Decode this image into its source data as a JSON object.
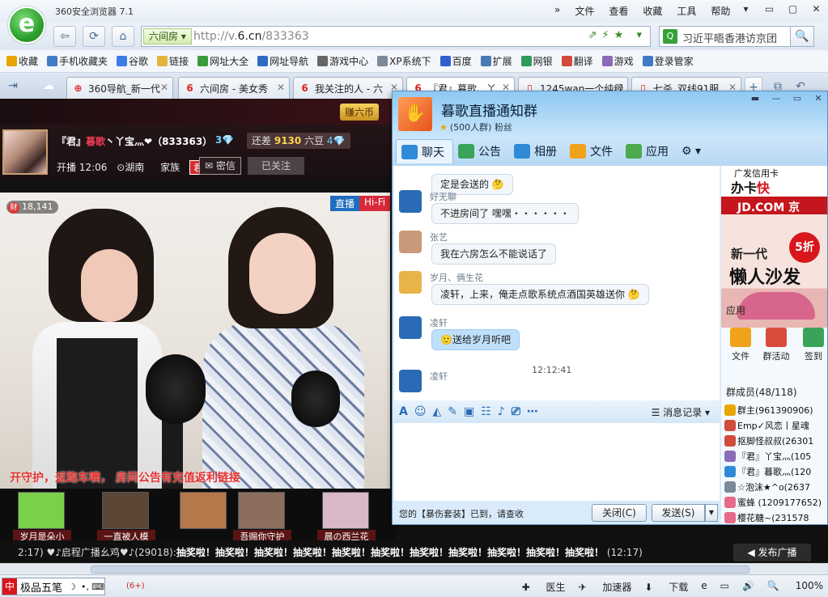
{
  "browser": {
    "title": "360安全浏览器 7.1",
    "menu": [
      "文件",
      "查看",
      "收藏",
      "工具",
      "帮助"
    ],
    "window_controls": [
      "▾",
      "▭",
      "▢",
      "✕"
    ],
    "address_tag": "六间房",
    "url_prefix": "http://v.",
    "url_domain": "6.cn",
    "url_path": "/833363",
    "search_value": "习近平晤香港访京团"
  },
  "favorites": [
    {
      "label": "收藏",
      "icon": "star-icon",
      "color": "#e8a600"
    },
    {
      "label": "手机收藏夹",
      "icon": "phone-icon",
      "color": "#3f7cc5"
    },
    {
      "label": "谷歌",
      "icon": "google-icon",
      "color": "#3b7ce6"
    },
    {
      "label": "链接",
      "icon": "folder-icon",
      "color": "#e3b33c"
    },
    {
      "label": "网址大全",
      "icon": "globe-icon",
      "color": "#3a9b3a"
    },
    {
      "label": "网址导航",
      "icon": "nav-icon",
      "color": "#2d6cc2"
    },
    {
      "label": "游戏中心",
      "icon": "gamepad-icon",
      "color": "#666666"
    },
    {
      "label": "XP系统下",
      "icon": "page-icon",
      "color": "#7a8a99"
    },
    {
      "label": "百度",
      "icon": "baidu-icon",
      "color": "#2f5fd0"
    },
    {
      "label": "扩展",
      "icon": "grid-icon",
      "color": "#4a7ab5"
    },
    {
      "label": "网银",
      "icon": "bank-icon",
      "color": "#2f9a5a"
    },
    {
      "label": "翻译",
      "icon": "translate-icon",
      "color": "#d14b3c"
    },
    {
      "label": "游戏",
      "icon": "game-icon",
      "color": "#8a6bb8"
    },
    {
      "label": "登录管家",
      "icon": "login-icon",
      "color": "#3f7cc5"
    }
  ],
  "tabs": [
    {
      "label": "360导航_新一代",
      "icon": "360-icon"
    },
    {
      "label": "六间房 - 美女秀",
      "icon": "6cn-icon"
    },
    {
      "label": "我关注的人 - 六",
      "icon": "6cn-icon"
    },
    {
      "label": "『君』暮歌、丫",
      "icon": "6cn-icon"
    },
    {
      "label": "1245wan一个纯绿",
      "icon": "page-icon"
    },
    {
      "label": "七杀_双线91服",
      "icon": "page-icon"
    }
  ],
  "room": {
    "earn_label": "赚六币",
    "host_name_prefix": "『君』",
    "host_name_hl": "暮歌",
    "host_name_rest": "丶丫宝灬❤（833363）",
    "host_level": "3💎",
    "beans_prefix": "还差",
    "beans_value": "9130",
    "beans_suffix": "六豆",
    "next_level": "4💎",
    "start_time": "开播 12:06",
    "location": "湖南",
    "family_label": "家族",
    "family_badge": "君",
    "pm_label": "密信",
    "follow_label": "已关注",
    "viewers": "18,141",
    "viewer_icon": "财",
    "live_label": "直播",
    "hifi_label": "Hi-Fi",
    "marquee": "开守护，返跑车噢，    房间公告有充值返利链接",
    "guards": [
      "岁月是朵小",
      "一直被人模",
      "",
      "吾赐你守护",
      "晨の西兰花"
    ],
    "ticker_prefix": "2:17) ♥♪启程广播幺鸡♥♪(29018):",
    "ticker_items": [
      "抽奖啦！",
      "抽奖啦！",
      "抽奖啦！",
      "抽奖啦！",
      "抽奖啦！",
      "抽奖啦！",
      "抽奖啦！",
      "抽奖啦！",
      "抽奖啦！",
      "抽奖啦！",
      "抽奖啦！"
    ],
    "ticker_time": "(12:17)",
    "broadcast_label": "发布广播"
  },
  "qq": {
    "group_name": "暮歌直播通知群",
    "group_sub": "(500人群) 粉丝",
    "tabs": [
      {
        "label": "聊天",
        "icon": "chat-icon",
        "color": "#2f8ad8"
      },
      {
        "label": "公告",
        "icon": "announce-icon",
        "color": "#3aa35a"
      },
      {
        "label": "相册",
        "icon": "album-icon",
        "color": "#2f8ad8"
      },
      {
        "label": "文件",
        "icon": "file-icon",
        "color": "#f0a21a"
      },
      {
        "label": "应用",
        "icon": "apps-icon",
        "color": "#4caa4c"
      }
    ],
    "messages": [
      {
        "who": "",
        "text": "定是会送的 🤔"
      },
      {
        "who": "好无聊",
        "text": "不进房间了  嘿嘿・・・・・・"
      },
      {
        "who": "张艺",
        "text": "我在六房怎么不能说话了"
      },
      {
        "who": "岁月、俩生花",
        "text": "凌轩，上来，俺走点歌系统点酒国英雄送你 🤔"
      },
      {
        "who": "凌轩",
        "text": "🙂送给岁月听吧"
      },
      {
        "who": "凌轩",
        "text": ""
      }
    ],
    "chat_time": "12:12:41",
    "history_label": "消息记录",
    "footer_note": "您的【暴伤套装】已到，请查收",
    "close_label": "关闭(C)",
    "send_label": "发送(S)",
    "ad_title": "广发信用卡",
    "ad_main_prefix": "办卡",
    "ad_main_hl": "快",
    "ad_jd": "JD.COM 京",
    "ad_discount": "5折",
    "ad_line1": "新一代",
    "ad_line2": "懒人沙发",
    "apps_title": "应用",
    "apps": [
      {
        "label": "文件",
        "color": "#f0a21a"
      },
      {
        "label": "群活动",
        "color": "#d94c3d"
      },
      {
        "label": "签到",
        "color": "#3aa35a"
      }
    ],
    "members_title": "群成员(48/118)",
    "members": [
      {
        "name": "群主(961390906)",
        "color": "#e8a600"
      },
      {
        "name": "Emp✓风恋丨星魂",
        "color": "#d14b3c"
      },
      {
        "name": "抠脚怪叔叔(26301",
        "color": "#d14b3c"
      },
      {
        "name": "『君』丫宝灬(105",
        "color": "#8a6bb8"
      },
      {
        "name": "『君』暮歌灬(120",
        "color": "#2f8ad8"
      },
      {
        "name": "☆泡沫★^o(2637",
        "color": "#7a8a99"
      },
      {
        "name": "蜜蜂 (1209177652)",
        "color": "#e86a8a"
      },
      {
        "name": "樱花糖~(231578",
        "color": "#e86a8a"
      }
    ]
  },
  "status": {
    "ime_name": "极品五笔",
    "ime_extra": "(6+)",
    "items": [
      "医生",
      "加速器",
      "下载",
      "",
      "100%"
    ]
  }
}
